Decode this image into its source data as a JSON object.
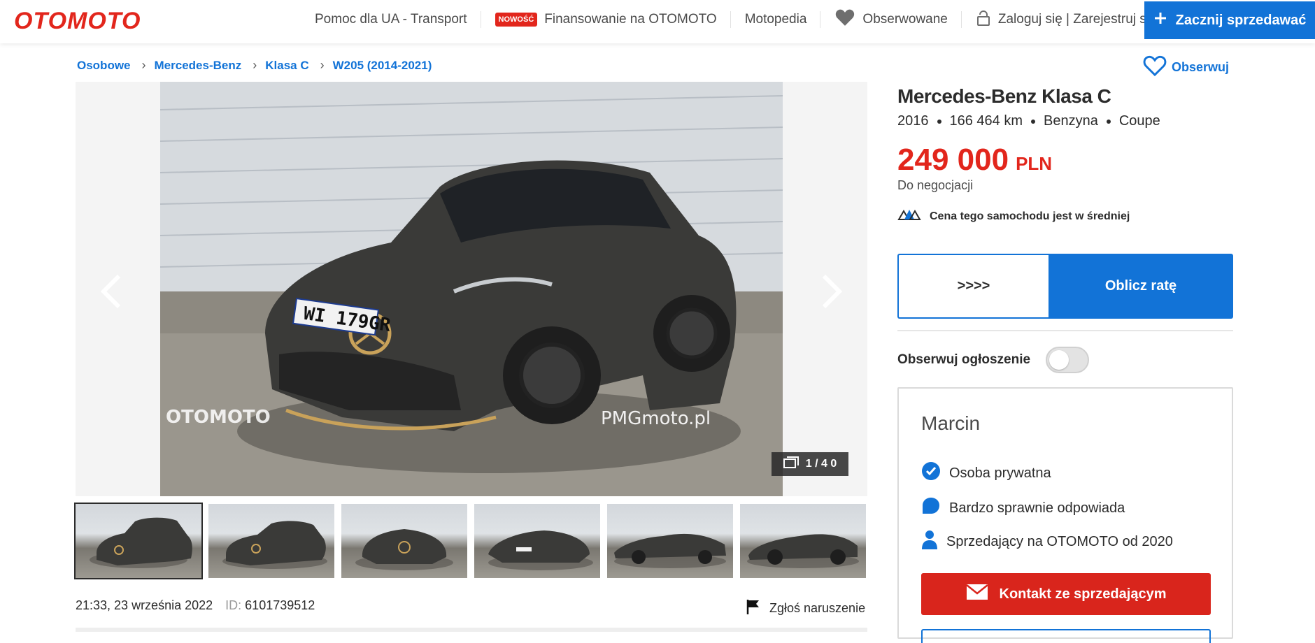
{
  "header": {
    "logo": "OTOMOTO",
    "nav": [
      {
        "label": "Pomoc dla UA - Transport"
      },
      {
        "badge": "NOWOŚĆ",
        "label": "Finansowanie na OTOMOTO"
      },
      {
        "label": "Motopedia"
      },
      {
        "label": "Obserwowane"
      },
      {
        "label": "Zaloguj się | Zarejestruj się"
      }
    ],
    "cta": "Zacznij sprzedawać"
  },
  "breadcrumb": [
    "Osobowe",
    "Mercedes-Benz",
    "Klasa C",
    "W205 (2014-2021)"
  ],
  "observe_label": "Obserwuj",
  "gallery": {
    "counter": "1 / 4 0",
    "watermark_left": "OTOMOTO",
    "watermark_right": "PMGmoto.pl",
    "plate": "WI 179GR",
    "thumb_count": 6
  },
  "listing": {
    "title": "Mercedes-Benz Klasa C",
    "year": "2016",
    "mileage": "166 464 km",
    "fuel": "Benzyna",
    "body": "Coupe",
    "price": "249 000",
    "currency": "PLN",
    "negotiable": "Do negocjacji",
    "price_eval": "Cena tego samochodu jest w średniej"
  },
  "actions": {
    "left_label": ">>>>",
    "right_label": "Oblicz ratę"
  },
  "follow": {
    "label": "Obserwuj ogłoszenie"
  },
  "seller": {
    "name": "Marcin",
    "type": "Osoba prywatna",
    "response": "Bardzo sprawnie odpowiada",
    "since": "Sprzedający na OTOMOTO od 2020",
    "contact": "Kontakt ze sprzedającym"
  },
  "meta": {
    "datetime": "21:33, 23 września 2022",
    "id_label": "ID:",
    "id_value": "6101739512",
    "report": "Zgłoś naruszenie"
  },
  "colors": {
    "brand_red": "#e2261c",
    "brand_blue": "#1273d7"
  }
}
